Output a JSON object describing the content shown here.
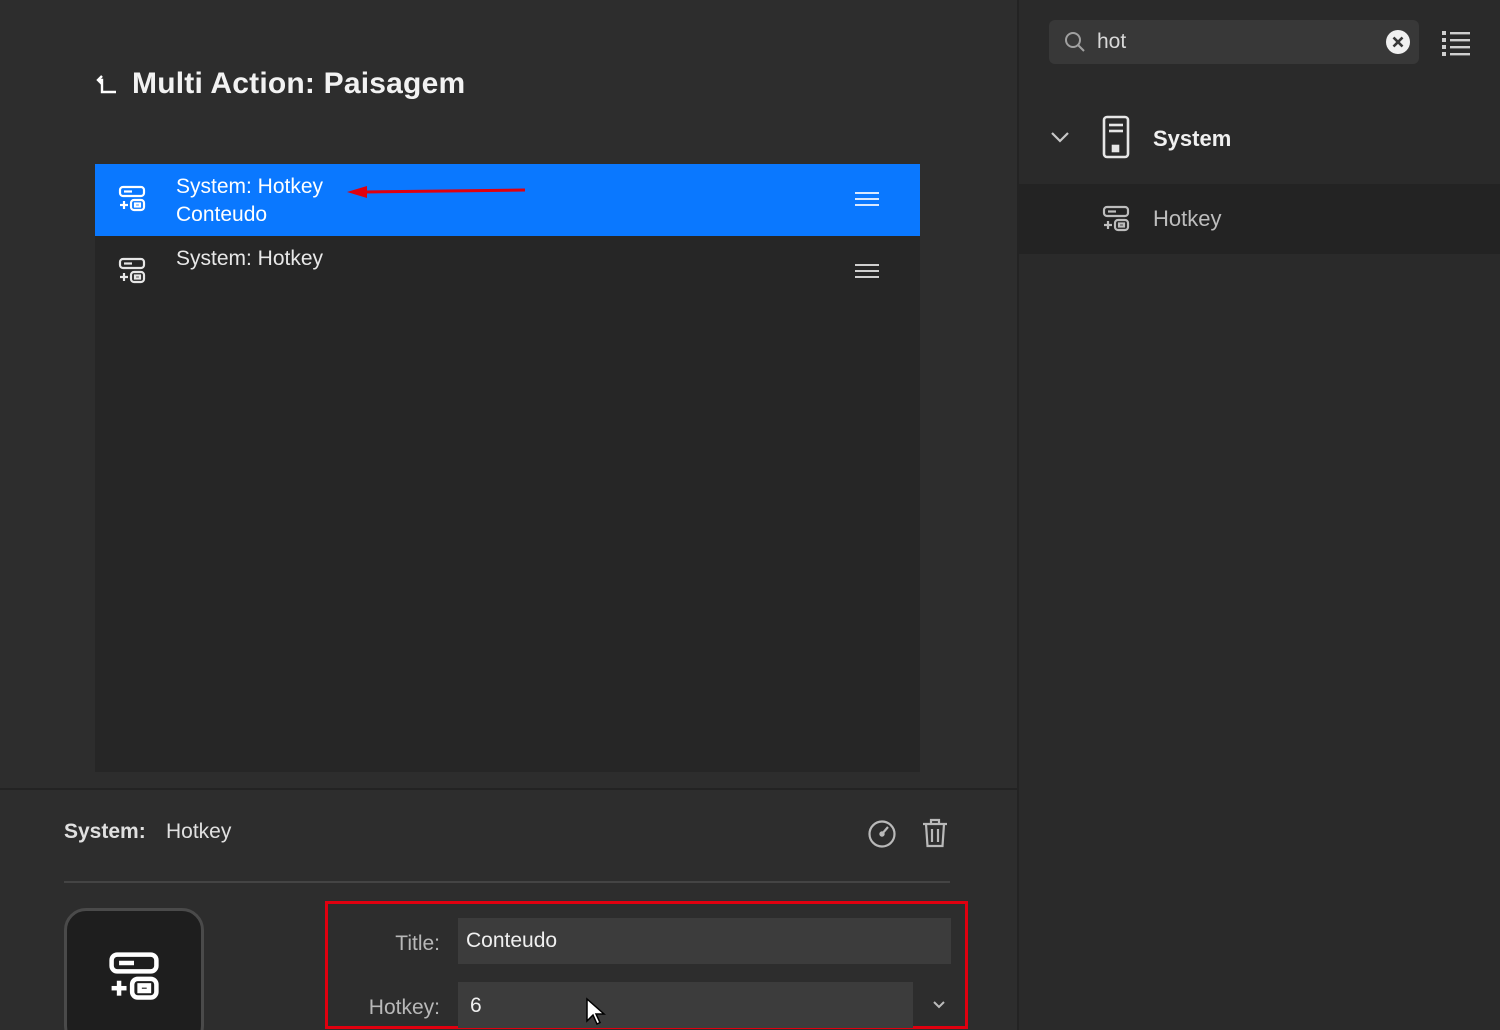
{
  "header": {
    "title": "Multi Action: Paisagem"
  },
  "actions": [
    {
      "line1": "System: Hotkey",
      "line2": "Conteudo",
      "selected": true
    },
    {
      "line1": "System: Hotkey",
      "line2": "",
      "selected": false
    }
  ],
  "inspector": {
    "category_label": "System:",
    "action_label": "Hotkey",
    "title_label": "Title:",
    "title_value": "Conteudo",
    "hotkey_label": "Hotkey:",
    "hotkey_value": "6"
  },
  "sidebar": {
    "search_value": "hot",
    "category": {
      "label": "System"
    },
    "item": {
      "label": "Hotkey"
    }
  },
  "colors": {
    "selection": "#0a78ff",
    "annotation": "#e0000f"
  }
}
